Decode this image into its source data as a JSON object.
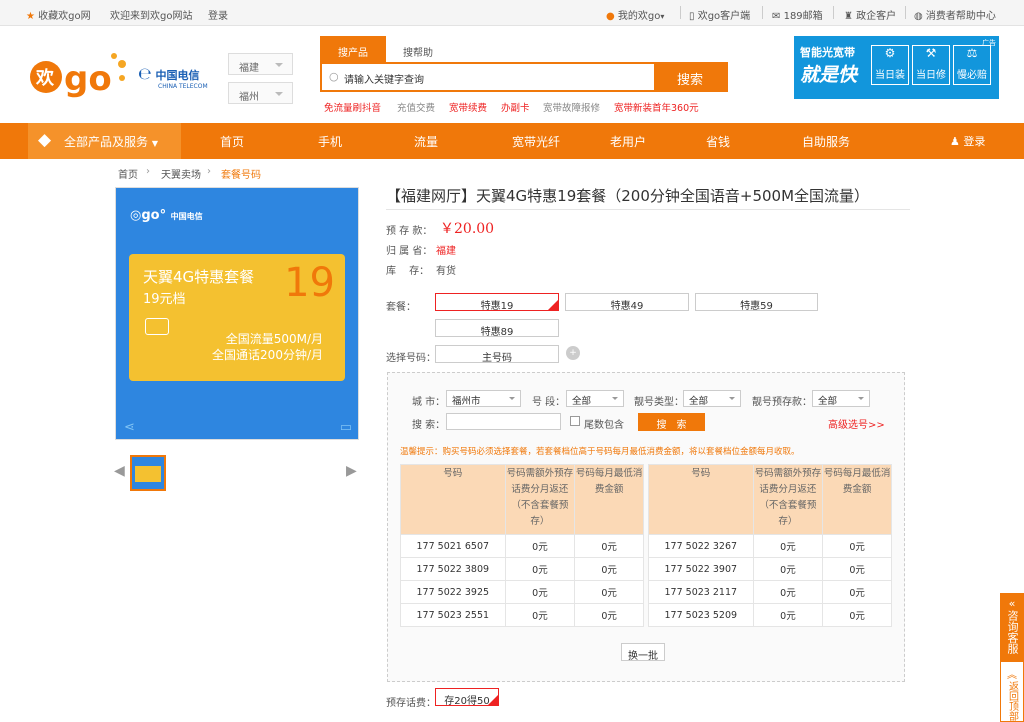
{
  "topbar": {
    "fav": "收藏欢go网",
    "welcome": "欢迎来到欢go网站",
    "login": "登录",
    "my": "我的欢go",
    "client": "欢go客户端",
    "mail": "189邮箱",
    "gov": "政企客户",
    "help": "消费者帮助中心"
  },
  "header": {
    "province": "福建",
    "city": "福州",
    "telecom_cn": "中国电信",
    "telecom_en": "CHINA TELECOM",
    "search_tab_product": "搜产品",
    "search_tab_help": "搜帮助",
    "search_value": "请输入关键字查询",
    "search_button": "搜索",
    "hot_links": [
      "免流量刷抖音",
      "充值交费",
      "宽带续费",
      "办副卡",
      "宽带故障报修",
      "宽带新装首年360元"
    ],
    "ad_line1": "智能光宽带",
    "ad_line2": "就是快",
    "ad_tag": "广告",
    "ad_items": [
      "当日装",
      "当日修",
      "慢必赔"
    ]
  },
  "nav": {
    "all": "全部产品及服务",
    "items": [
      "首页",
      "手机",
      "流量",
      "宽带光纤",
      "老用户",
      "省钱",
      "自助服务"
    ],
    "login": "登录"
  },
  "breadcrumb": [
    "首页",
    "天翼卖场",
    "套餐号码"
  ],
  "product_image": {
    "card_title": "天翼4G特惠套餐",
    "card_sub": "19元档",
    "card_num": "19",
    "line1": "全国流量500M/月",
    "line2": "全国通话200分钟/月"
  },
  "product": {
    "title": "【福建网厅】天翼4G特惠19套餐（200分钟全国语音+500M全国流量）",
    "deposit_label": "预 存 款：",
    "deposit_value": "￥20.00",
    "region_label": "归 属 省：",
    "region_value": "福建",
    "stock_label": "库　 存：",
    "stock_value": "有货",
    "package_label": "套餐：",
    "packages": [
      "特惠19",
      "特惠49",
      "特惠59",
      "特惠89"
    ],
    "number_label": "选择号码：",
    "number_option": "主号码",
    "prestore_label": "预存话费：",
    "prestore_option": "存20得50"
  },
  "filter": {
    "city_label": "城 市：",
    "city_value": "福州市",
    "segment_label": "号 段：",
    "segment_value": "全部",
    "type_label": "靓号类型：",
    "type_value": "全部",
    "prestore_label": "靓号预存款：",
    "prestore_value": "全部",
    "search_label": "搜 索：",
    "tail_label": "尾数包含",
    "search_button": "搜　索",
    "advanced": "高级选号>>",
    "tip": "温馨提示：购买号码必须选择套餐，若套餐档位高于号码每月最低消费金额，将以套餐档位金额每月收取。",
    "headers": [
      "号码",
      "号码需额外预存话费分月返还（不含套餐预存）",
      "号码每月最低消费金额"
    ],
    "left_rows": [
      [
        "177 5021 6507",
        "0元",
        "0元"
      ],
      [
        "177 5022 3809",
        "0元",
        "0元"
      ],
      [
        "177 5022 3925",
        "0元",
        "0元"
      ],
      [
        "177 5023 2551",
        "0元",
        "0元"
      ]
    ],
    "right_rows": [
      [
        "177 5022 3267",
        "0元",
        "0元"
      ],
      [
        "177 5022 3907",
        "0元",
        "0元"
      ],
      [
        "177 5023 2117",
        "0元",
        "0元"
      ],
      [
        "177 5023 5209",
        "0元",
        "0元"
      ]
    ],
    "refresh": "换一批"
  },
  "side": {
    "consult": "咨询客服",
    "top": "返回顶部"
  },
  "colors": {
    "accent": "#f0780a",
    "price": "#e22222",
    "blue": "#1296dc"
  }
}
